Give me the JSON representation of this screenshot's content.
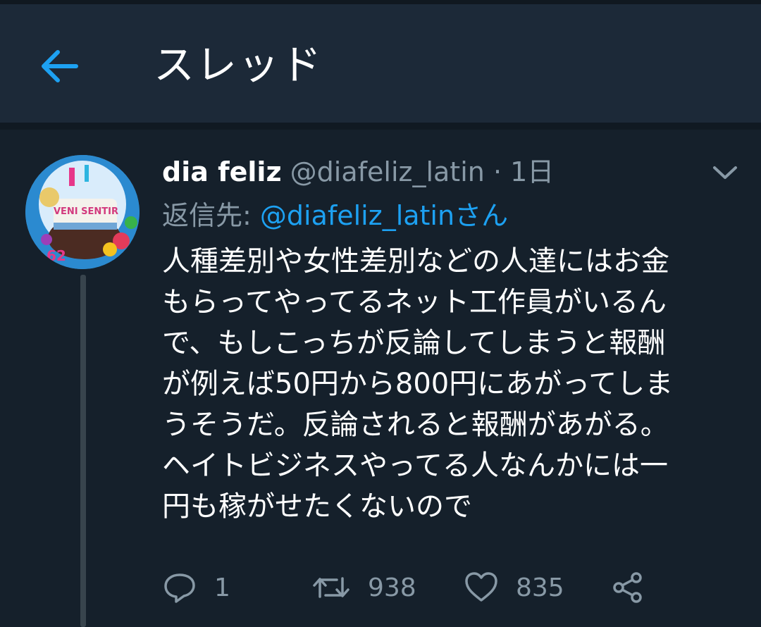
{
  "header": {
    "title": "スレッド",
    "back_icon": "arrow-left-icon",
    "accent": "#1da1f2"
  },
  "tweet": {
    "author_name": "dia feliz",
    "handle": "@diafeliz_latin",
    "separator": "·",
    "time": "1日",
    "reply_label": "返信先:",
    "reply_mention": "@diafeliz_latinさん",
    "text": "人種差別や女性差別などの人達にはお金\nもらってやってるネット工作員がいるん\nで、もしこっちが反論してしまうと報酬\nが例えば50円から800円にあがってしま\nうそうだ。反論されると報酬があがる。\nヘイトビジネスやってる人なんかには一\n円も稼がせたくないので",
    "avatar_badge": "62",
    "avatar_text": "VENI SENTIR"
  },
  "actions": {
    "reply_count": "1",
    "retweet_count": "938",
    "like_count": "835"
  },
  "colors": {
    "background": "#15202b",
    "header": "#1c2938",
    "muted": "#8899a6"
  }
}
